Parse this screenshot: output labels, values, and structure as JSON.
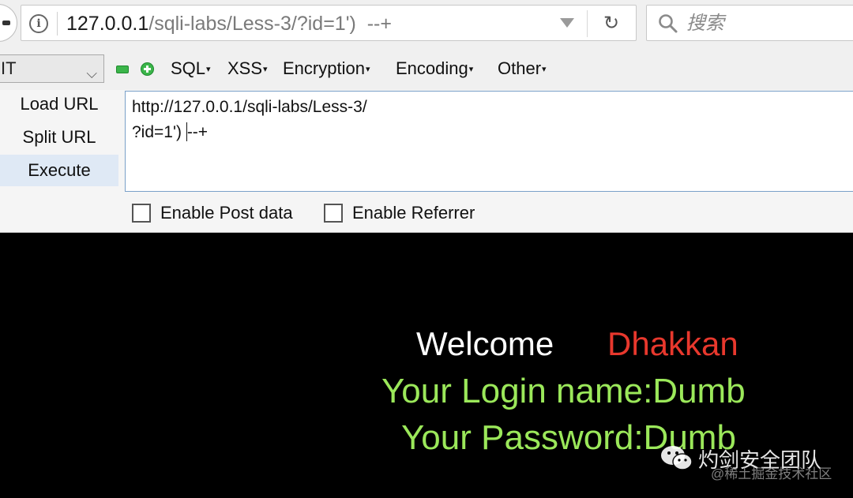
{
  "browser": {
    "url_host": "127.0.0.1",
    "url_path": "/sqli-labs/Less-3/?id=1')  --+",
    "search_placeholder": "搜索"
  },
  "hackbar": {
    "method_value": "IT",
    "menus": [
      "SQL",
      "XSS",
      "Encryption",
      "Encoding",
      "Other"
    ],
    "buttons": {
      "load": "Load URL",
      "split": "Split URL",
      "execute": "Execute"
    },
    "url_lines": [
      "http://127.0.0.1/sqli-labs/Less-3/",
      "?id=1') ",
      "--+"
    ],
    "post_label": "Enable Post data",
    "referrer_label": "Enable Referrer"
  },
  "page": {
    "welcome": "Welcome",
    "name": "Dhakkan",
    "login_line": "Your Login name:Dumb",
    "password_line": "Your Password:Dumb"
  },
  "watermark": {
    "title": "灼剑安全团队",
    "subtitle": "@稀土掘金技术社区"
  },
  "colors": {
    "welcome": "#ffffff",
    "name": "#e8382d",
    "green": "#9be85a",
    "background": "#000000"
  }
}
